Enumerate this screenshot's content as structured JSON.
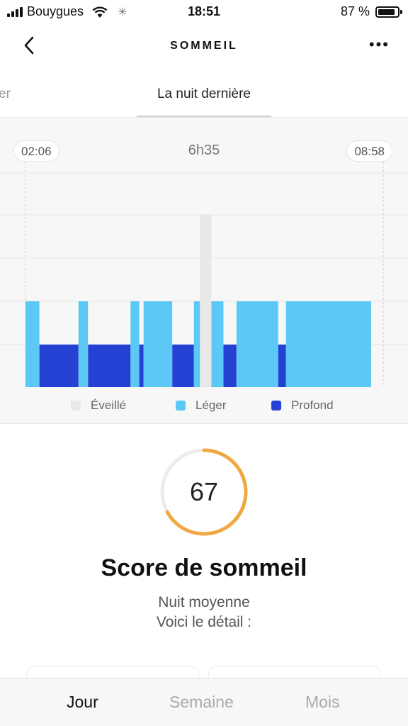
{
  "status_bar": {
    "carrier": "Bouygues",
    "time": "18:51",
    "battery": "87 %",
    "battery_level": 0.87
  },
  "header": {
    "title": "SOMMEIL",
    "back_icon": "chevron-left-icon",
    "more_icon": "more-dots-icon"
  },
  "tabs": {
    "previous_partial": "er",
    "active": "La nuit dernière"
  },
  "chart": {
    "start_time": "02:06",
    "end_time": "08:58",
    "duration": "6h35"
  },
  "chart_data": {
    "type": "bar",
    "title": "",
    "stages": [
      "Éveillé",
      "Léger",
      "Profond"
    ],
    "colors": {
      "Éveillé": "#e8e8e8",
      "Léger": "#5bc8f5",
      "Profond": "#2541d3"
    },
    "legend_position": "bottom",
    "x_range": [
      "02:06",
      "08:58"
    ],
    "segments": [
      {
        "stage": "Léger",
        "start": "02:06",
        "end": "02:22"
      },
      {
        "stage": "Profond",
        "start": "02:22",
        "end": "03:07"
      },
      {
        "stage": "Léger",
        "start": "03:07",
        "end": "03:18"
      },
      {
        "stage": "Profond",
        "start": "03:18",
        "end": "04:07"
      },
      {
        "stage": "Léger",
        "start": "04:07",
        "end": "04:17"
      },
      {
        "stage": "Profond",
        "start": "04:17",
        "end": "04:22"
      },
      {
        "stage": "Léger",
        "start": "04:22",
        "end": "04:55"
      },
      {
        "stage": "Profond",
        "start": "04:55",
        "end": "05:20"
      },
      {
        "stage": "Léger",
        "start": "05:20",
        "end": "05:27"
      },
      {
        "stage": "Éveillé",
        "start": "05:27",
        "end": "05:40"
      },
      {
        "stage": "Léger",
        "start": "05:40",
        "end": "05:54"
      },
      {
        "stage": "Profond",
        "start": "05:54",
        "end": "06:09"
      },
      {
        "stage": "Léger",
        "start": "06:09",
        "end": "06:57"
      },
      {
        "stage": "Profond",
        "start": "06:57",
        "end": "07:06"
      },
      {
        "stage": "Léger",
        "start": "07:06",
        "end": "08:44"
      }
    ]
  },
  "legend": {
    "awake": "Éveillé",
    "light": "Léger",
    "deep": "Profond"
  },
  "score": {
    "value": "67",
    "ring_fraction": 0.67,
    "ring_color": "#f0a843",
    "title": "Score de sommeil",
    "line1": "Nuit moyenne",
    "line2": "Voici le détail :"
  },
  "bottom_tabs": {
    "day": "Jour",
    "week": "Semaine",
    "month": "Mois",
    "active": "Jour"
  }
}
